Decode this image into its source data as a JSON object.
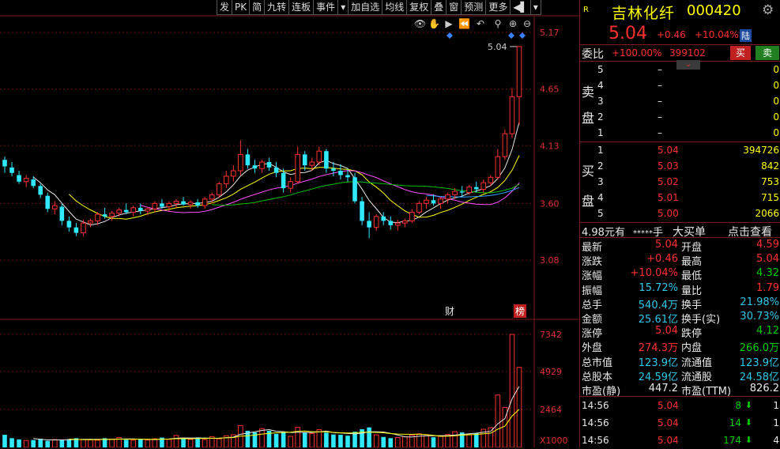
{
  "toolbar": {
    "items": [
      "发",
      "PK",
      "简",
      "九转",
      "连板",
      "事件",
      "▾",
      "加自选",
      "均线",
      "复权",
      "叠",
      "窗",
      "预测",
      "更多",
      "◀▌",
      "▾"
    ]
  },
  "chart_data": {
    "type": "candlestick",
    "price_axis_ticks": [
      "5.17",
      "4.65",
      "4.13",
      "3.60",
      "3.08"
    ],
    "volume_axis_ticks": [
      "7342",
      "4929",
      "2464",
      "X1000"
    ],
    "high_label": "5.04",
    "markers": [
      "财",
      "榜"
    ],
    "candles": [
      {
        "o": 4.0,
        "h": 4.03,
        "l": 3.88,
        "c": 3.94
      },
      {
        "o": 3.93,
        "h": 3.98,
        "l": 3.85,
        "c": 3.88
      },
      {
        "o": 3.86,
        "h": 3.9,
        "l": 3.78,
        "c": 3.8
      },
      {
        "o": 3.8,
        "h": 3.86,
        "l": 3.75,
        "c": 3.83
      },
      {
        "o": 3.82,
        "h": 3.85,
        "l": 3.74,
        "c": 3.76
      },
      {
        "o": 3.76,
        "h": 3.78,
        "l": 3.65,
        "c": 3.68
      },
      {
        "o": 3.67,
        "h": 3.7,
        "l": 3.52,
        "c": 3.55
      },
      {
        "o": 3.55,
        "h": 3.62,
        "l": 3.5,
        "c": 3.58
      },
      {
        "o": 3.57,
        "h": 3.6,
        "l": 3.4,
        "c": 3.44
      },
      {
        "o": 3.44,
        "h": 3.48,
        "l": 3.34,
        "c": 3.38
      },
      {
        "o": 3.38,
        "h": 3.42,
        "l": 3.3,
        "c": 3.33
      },
      {
        "o": 3.33,
        "h": 3.45,
        "l": 3.3,
        "c": 3.42
      },
      {
        "o": 3.42,
        "h": 3.46,
        "l": 3.38,
        "c": 3.44
      },
      {
        "o": 3.44,
        "h": 3.52,
        "l": 3.4,
        "c": 3.5
      },
      {
        "o": 3.5,
        "h": 3.56,
        "l": 3.46,
        "c": 3.48
      },
      {
        "o": 3.48,
        "h": 3.53,
        "l": 3.44,
        "c": 3.51
      },
      {
        "o": 3.51,
        "h": 3.56,
        "l": 3.48,
        "c": 3.54
      },
      {
        "o": 3.54,
        "h": 3.6,
        "l": 3.5,
        "c": 3.52
      },
      {
        "o": 3.52,
        "h": 3.58,
        "l": 3.48,
        "c": 3.56
      },
      {
        "o": 3.56,
        "h": 3.6,
        "l": 3.5,
        "c": 3.53
      },
      {
        "o": 3.53,
        "h": 3.57,
        "l": 3.49,
        "c": 3.55
      },
      {
        "o": 3.55,
        "h": 3.62,
        "l": 3.52,
        "c": 3.6
      },
      {
        "o": 3.6,
        "h": 3.64,
        "l": 3.55,
        "c": 3.57
      },
      {
        "o": 3.57,
        "h": 3.62,
        "l": 3.53,
        "c": 3.6
      },
      {
        "o": 3.6,
        "h": 3.64,
        "l": 3.56,
        "c": 3.62
      },
      {
        "o": 3.62,
        "h": 3.66,
        "l": 3.58,
        "c": 3.59
      },
      {
        "o": 3.59,
        "h": 3.63,
        "l": 3.55,
        "c": 3.61
      },
      {
        "o": 3.61,
        "h": 3.64,
        "l": 3.56,
        "c": 3.58
      },
      {
        "o": 3.58,
        "h": 3.66,
        "l": 3.55,
        "c": 3.64
      },
      {
        "o": 3.64,
        "h": 3.7,
        "l": 3.6,
        "c": 3.68
      },
      {
        "o": 3.68,
        "h": 3.8,
        "l": 3.65,
        "c": 3.78
      },
      {
        "o": 3.78,
        "h": 3.9,
        "l": 3.74,
        "c": 3.85
      },
      {
        "o": 3.85,
        "h": 3.95,
        "l": 3.8,
        "c": 3.9
      },
      {
        "o": 3.9,
        "h": 4.18,
        "l": 3.86,
        "c": 4.05
      },
      {
        "o": 4.05,
        "h": 4.1,
        "l": 3.92,
        "c": 3.95
      },
      {
        "o": 3.95,
        "h": 4.0,
        "l": 3.88,
        "c": 3.92
      },
      {
        "o": 3.92,
        "h": 4.0,
        "l": 3.88,
        "c": 3.98
      },
      {
        "o": 3.98,
        "h": 4.02,
        "l": 3.9,
        "c": 3.93
      },
      {
        "o": 3.93,
        "h": 3.98,
        "l": 3.84,
        "c": 3.88
      },
      {
        "o": 3.88,
        "h": 3.92,
        "l": 3.7,
        "c": 3.74
      },
      {
        "o": 3.74,
        "h": 3.84,
        "l": 3.7,
        "c": 3.8
      },
      {
        "o": 3.8,
        "h": 4.12,
        "l": 3.78,
        "c": 4.05
      },
      {
        "o": 4.05,
        "h": 4.08,
        "l": 3.9,
        "c": 3.95
      },
      {
        "o": 3.95,
        "h": 4.02,
        "l": 3.9,
        "c": 3.98
      },
      {
        "o": 3.98,
        "h": 4.12,
        "l": 3.95,
        "c": 4.08
      },
      {
        "o": 4.08,
        "h": 4.1,
        "l": 3.88,
        "c": 3.92
      },
      {
        "o": 3.92,
        "h": 3.98,
        "l": 3.85,
        "c": 3.9
      },
      {
        "o": 3.9,
        "h": 3.96,
        "l": 3.82,
        "c": 3.86
      },
      {
        "o": 3.86,
        "h": 3.92,
        "l": 3.8,
        "c": 3.84
      },
      {
        "o": 3.84,
        "h": 3.88,
        "l": 3.6,
        "c": 3.62
      },
      {
        "o": 3.62,
        "h": 3.66,
        "l": 3.4,
        "c": 3.44
      },
      {
        "o": 3.44,
        "h": 3.52,
        "l": 3.28,
        "c": 3.38
      },
      {
        "o": 3.38,
        "h": 3.5,
        "l": 3.35,
        "c": 3.48
      },
      {
        "o": 3.48,
        "h": 3.52,
        "l": 3.4,
        "c": 3.44
      },
      {
        "o": 3.44,
        "h": 3.48,
        "l": 3.36,
        "c": 3.4
      },
      {
        "o": 3.4,
        "h": 3.45,
        "l": 3.35,
        "c": 3.42
      },
      {
        "o": 3.42,
        "h": 3.46,
        "l": 3.38,
        "c": 3.44
      },
      {
        "o": 3.44,
        "h": 3.55,
        "l": 3.42,
        "c": 3.52
      },
      {
        "o": 3.52,
        "h": 3.62,
        "l": 3.5,
        "c": 3.6
      },
      {
        "o": 3.6,
        "h": 3.66,
        "l": 3.55,
        "c": 3.63
      },
      {
        "o": 3.63,
        "h": 3.68,
        "l": 3.58,
        "c": 3.6
      },
      {
        "o": 3.6,
        "h": 3.66,
        "l": 3.55,
        "c": 3.64
      },
      {
        "o": 3.64,
        "h": 3.7,
        "l": 3.6,
        "c": 3.68
      },
      {
        "o": 3.68,
        "h": 3.74,
        "l": 3.64,
        "c": 3.71
      },
      {
        "o": 3.71,
        "h": 3.76,
        "l": 3.66,
        "c": 3.7
      },
      {
        "o": 3.7,
        "h": 3.77,
        "l": 3.68,
        "c": 3.75
      },
      {
        "o": 3.75,
        "h": 3.8,
        "l": 3.7,
        "c": 3.73
      },
      {
        "o": 3.73,
        "h": 3.82,
        "l": 3.7,
        "c": 3.79
      },
      {
        "o": 3.79,
        "h": 3.86,
        "l": 3.76,
        "c": 3.84
      },
      {
        "o": 3.84,
        "h": 4.1,
        "l": 3.82,
        "c": 4.03
      },
      {
        "o": 4.03,
        "h": 4.28,
        "l": 4.0,
        "c": 4.24
      },
      {
        "o": 4.24,
        "h": 4.66,
        "l": 4.2,
        "c": 4.58
      },
      {
        "o": 4.58,
        "h": 5.04,
        "l": 4.32,
        "c": 5.04
      }
    ],
    "volumes": [
      820,
      600,
      520,
      450,
      480,
      560,
      430,
      510,
      470,
      540,
      600,
      520,
      490,
      470,
      600,
      530,
      640,
      500,
      470,
      520,
      480,
      560,
      640,
      520,
      780,
      590,
      520,
      650,
      510,
      700,
      560,
      760,
      820,
      1420,
      1080,
      980,
      1220,
      1080,
      880,
      960,
      720,
      1300,
      980,
      900,
      1150,
      960,
      840,
      820,
      760,
      1020,
      1180,
      1300,
      820,
      680,
      600,
      640,
      700,
      800,
      880,
      760,
      660,
      720,
      840,
      1020,
      980,
      860,
      920,
      1180,
      1280,
      3400,
      2600,
      7342,
      5200
    ]
  },
  "panel": {
    "badge": "R",
    "stock_name": "吉林化纤",
    "stock_code": "000420",
    "price": "5.04",
    "change": "+0.46",
    "change_pct": "+10.04%",
    "board_tag": "陆",
    "weibi_label": "委比",
    "weibi_value": "+100.00%",
    "weicha_value": "399102",
    "buy_btn": "买",
    "sell_btn": "卖",
    "sell_label_1": "卖",
    "sell_label_2": "盘",
    "buy_label_1": "买",
    "buy_label_2": "盘",
    "asks": [
      {
        "lvl": "5",
        "price": "–",
        "vol": "0"
      },
      {
        "lvl": "4",
        "price": "–",
        "vol": "0"
      },
      {
        "lvl": "3",
        "price": "–",
        "vol": "0"
      },
      {
        "lvl": "2",
        "price": "–",
        "vol": "0"
      },
      {
        "lvl": "1",
        "price": "–",
        "vol": "0"
      }
    ],
    "bids": [
      {
        "lvl": "1",
        "price": "5.04",
        "vol": "394726"
      },
      {
        "lvl": "2",
        "price": "5.03",
        "vol": "842"
      },
      {
        "lvl": "3",
        "price": "5.02",
        "vol": "753"
      },
      {
        "lvl": "4",
        "price": "5.01",
        "vol": "715"
      },
      {
        "lvl": "5",
        "price": "5.00",
        "vol": "2066"
      }
    ],
    "bigorder": {
      "amount": "4.98",
      "unit": "元有",
      "mask": "*****",
      "hand": "手",
      "title": "大买单",
      "link": "点击查看"
    },
    "stats": [
      {
        "k1": "最新",
        "v1": "5.04",
        "c1": "red",
        "k2": "开盘",
        "v2": "4.59",
        "c2": "red"
      },
      {
        "k1": "涨跌",
        "v1": "+0.46",
        "c1": "red",
        "k2": "最高",
        "v2": "5.04",
        "c2": "red"
      },
      {
        "k1": "涨幅",
        "v1": "+10.04%",
        "c1": "red",
        "k2": "最低",
        "v2": "4.32",
        "c2": "green"
      },
      {
        "k1": "振幅",
        "v1": "15.72%",
        "c1": "cyan",
        "k2": "量比",
        "v2": "1.79",
        "c2": "red"
      },
      {
        "k1": "总手",
        "v1": "540.4万",
        "c1": "cyan",
        "k2": "换手",
        "v2": "21.98%",
        "c2": "cyan"
      },
      {
        "k1": "金额",
        "v1": "25.61亿",
        "c1": "cyan",
        "k2": "换手(实)",
        "v2": "30.73%",
        "c2": "cyan"
      },
      {
        "k1": "涨停",
        "v1": "5.04",
        "c1": "red",
        "k2": "跌停",
        "v2": "4.12",
        "c2": "green"
      },
      {
        "k1": "外盘",
        "v1": "274.3万",
        "c1": "red",
        "k2": "内盘",
        "v2": "266.0万",
        "c2": "green"
      },
      {
        "k1": "总市值",
        "v1": "123.9亿",
        "c1": "cyan",
        "k2": "流通值",
        "v2": "123.9亿",
        "c2": "cyan"
      },
      {
        "k1": "总股本",
        "v1": "24.59亿",
        "c1": "cyan",
        "k2": "流通股",
        "v2": "24.58亿",
        "c2": "cyan"
      },
      {
        "k1": "市盈(静)",
        "v1": "447.2",
        "c1": "white",
        "k2": "市盈(TTM)",
        "v2": "826.2",
        "c2": "white"
      }
    ],
    "ticks": [
      {
        "time": "14:56",
        "price": "5.04",
        "vol": "8",
        "dir": "down",
        "n": "1"
      },
      {
        "time": "14:56",
        "price": "5.04",
        "vol": "14",
        "dir": "down",
        "n": "1"
      },
      {
        "time": "14:56",
        "price": "5.04",
        "vol": "174",
        "dir": "down",
        "n": "4"
      }
    ]
  }
}
